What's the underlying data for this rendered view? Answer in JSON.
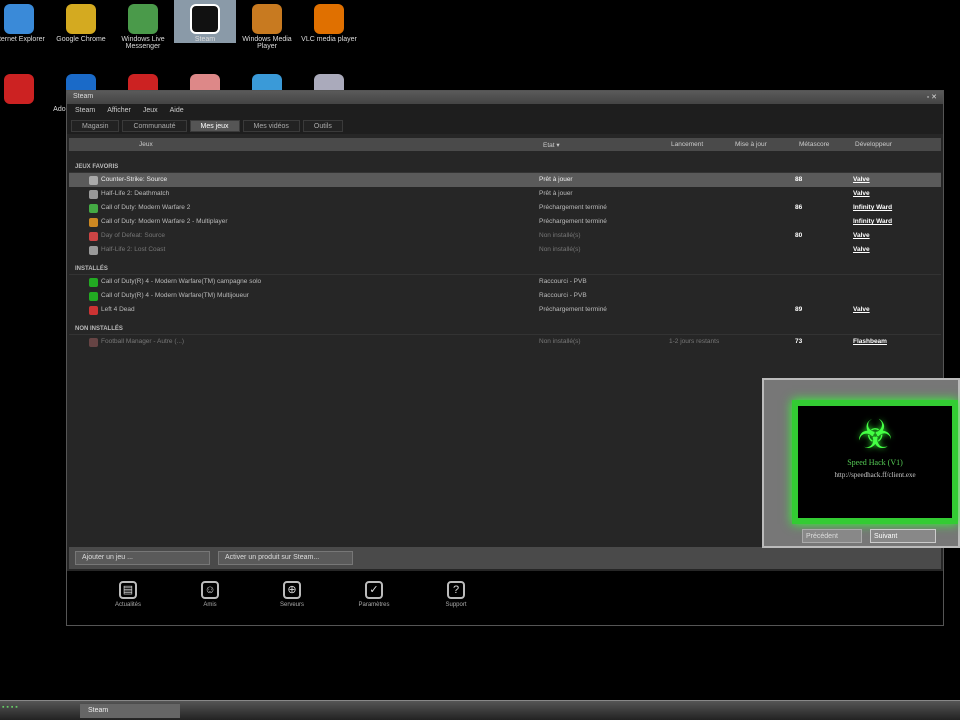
{
  "desktop": {
    "icons": [
      {
        "label": "Internet Explorer",
        "color": "#3a8ad8"
      },
      {
        "label": "Google Chrome",
        "color": "#d4aa20"
      },
      {
        "label": "Windows Live Messenger",
        "color": "#4a9a4a"
      },
      {
        "label": "Steam",
        "color": "#111"
      },
      {
        "label": "Windows Media Player",
        "color": "#c87a20"
      },
      {
        "label": "VLC media player",
        "color": "#e07000"
      }
    ],
    "row2_labels": [
      "Adobe Photoshop"
    ]
  },
  "window": {
    "title": "Steam",
    "menu": [
      "Steam",
      "Afficher",
      "Jeux",
      "Aide"
    ],
    "tabs": [
      "Magasin",
      "Communauté",
      "Mes jeux",
      "Mes vidéos",
      "Outils"
    ],
    "active_tab": 2,
    "columns": [
      "Jeux",
      "Etat ▾",
      "Lancement",
      "Mise à jour",
      "Métascore",
      "Développeur"
    ],
    "sections": [
      {
        "title": "JEUX FAVORIS",
        "games": [
          {
            "name": "Counter-Strike: Source",
            "status": "Prêt à jouer",
            "launch": "",
            "meta": "88",
            "dev": "Valve",
            "color": "#aaa",
            "hl": true
          },
          {
            "name": "Half-Life 2: Deathmatch",
            "status": "Prêt à jouer",
            "launch": "",
            "meta": "",
            "dev": "Valve",
            "color": "#999"
          },
          {
            "name": "Call of Duty: Modern Warfare 2",
            "status": "Préchargement terminé",
            "launch": "",
            "meta": "86",
            "dev": "Infinity Ward",
            "color": "#4a4"
          },
          {
            "name": "Call of Duty: Modern Warfare 2 - Multiplayer",
            "status": "Préchargement terminé",
            "launch": "",
            "meta": "",
            "dev": "Infinity Ward",
            "color": "#c82"
          },
          {
            "name": "Day of Defeat: Source",
            "status": "Non installé(s)",
            "launch": "",
            "meta": "80",
            "dev": "Valve",
            "color": "#c44",
            "dim": true
          },
          {
            "name": "Half-Life 2: Lost Coast",
            "status": "Non installé(s)",
            "launch": "",
            "meta": "",
            "dev": "Valve",
            "color": "#999",
            "dim": true
          }
        ]
      },
      {
        "title": "INSTALLÉS",
        "games": [
          {
            "name": "Call of Duty(R) 4 - Modern Warfare(TM) campagne solo",
            "status": "Raccourci - PVB",
            "launch": "",
            "meta": "",
            "dev": "",
            "color": "#2a2"
          },
          {
            "name": "Call of Duty(R) 4 - Modern Warfare(TM) Multijoueur",
            "status": "Raccourci - PVB",
            "launch": "",
            "meta": "",
            "dev": "",
            "color": "#2a2"
          },
          {
            "name": "Left 4 Dead",
            "status": "Préchargement terminé",
            "launch": "",
            "meta": "89",
            "dev": "Valve",
            "color": "#c33"
          }
        ]
      },
      {
        "title": "NON INSTALLÉS",
        "games": [
          {
            "name": "Football Manager - Autre (...)",
            "status": "Non installé(s)",
            "launch": "1-2 jours restants",
            "meta": "73",
            "dev": "Flashbeam",
            "color": "#644",
            "dim": true
          }
        ]
      }
    ],
    "add_game": "Ajouter un jeu ...",
    "activate": "Activer un produit sur Steam...",
    "bottom": [
      "Actualités",
      "Amis",
      "Serveurs",
      "Paramètres",
      "Support"
    ]
  },
  "popup": {
    "title": "Speed Hack (V1)",
    "url": "http://speedhack.ff/client.exe",
    "btn_prev": "Précédent",
    "btn_next": "Suivant"
  },
  "taskbar": {
    "steam": "Steam"
  }
}
